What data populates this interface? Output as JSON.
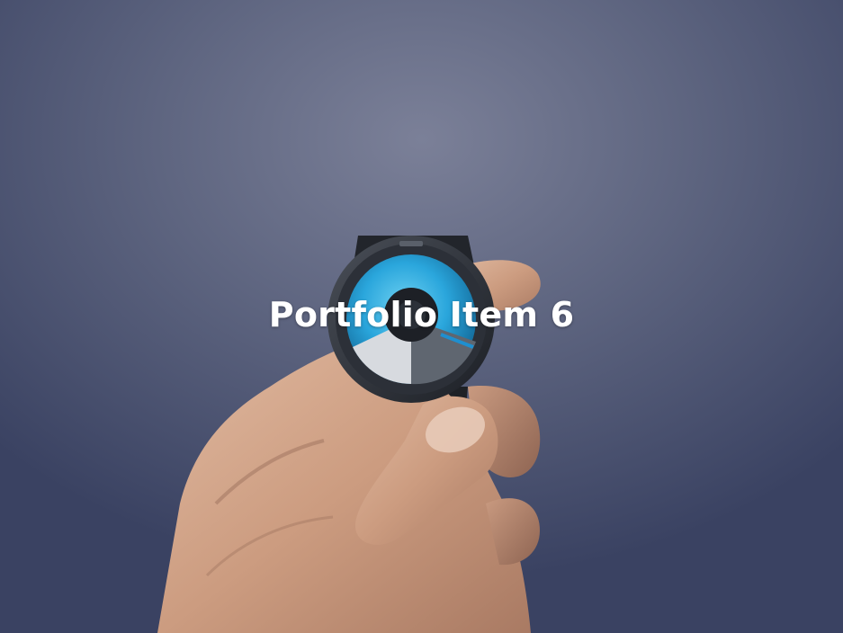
{
  "portfolio_item": {
    "title": "Portfolio Item 6",
    "image_subject": "hand-holding-watch-photo",
    "colors": {
      "background": "#4a5170",
      "watch_dial_accent": "#1f8fcf",
      "title_text": "#ffffff"
    }
  }
}
